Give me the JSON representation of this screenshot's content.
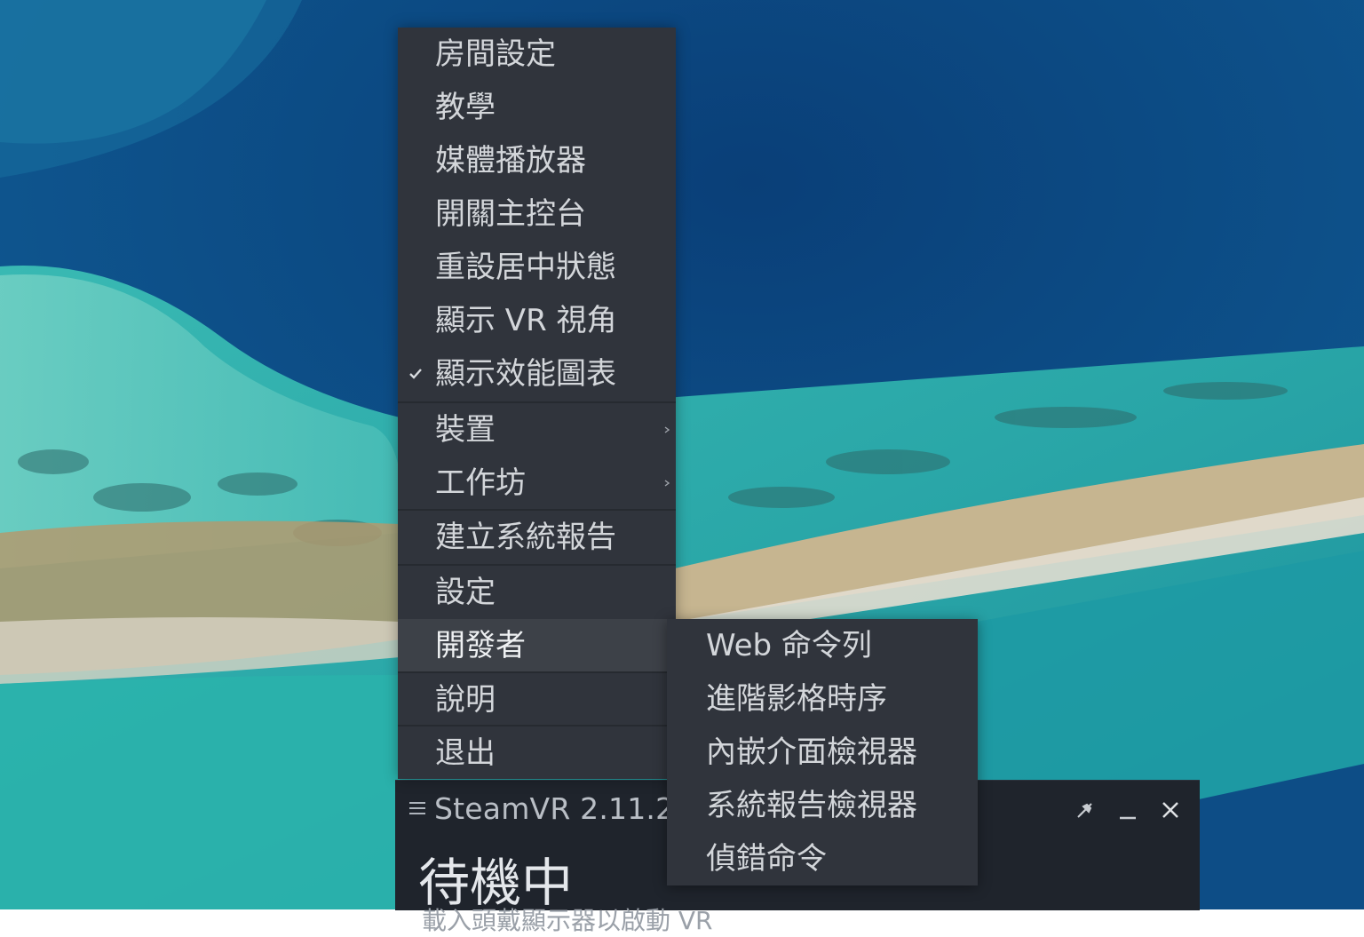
{
  "main_menu": {
    "items": [
      {
        "label": "房間設定"
      },
      {
        "label": "教學"
      },
      {
        "label": "媒體播放器"
      },
      {
        "label": "開關主控台"
      },
      {
        "label": "重設居中狀態"
      },
      {
        "label": "顯示 VR 視角"
      },
      {
        "label": "顯示效能圖表",
        "checked": true
      },
      {
        "label": "裝置",
        "has_submenu": true
      },
      {
        "label": "工作坊",
        "has_submenu": true
      },
      {
        "label": "建立系統報告"
      },
      {
        "label": "設定"
      },
      {
        "label": "開發者",
        "active": true
      },
      {
        "label": "說明"
      },
      {
        "label": "退出"
      }
    ]
  },
  "developer_submenu": {
    "items": [
      {
        "label": "Web 命令列"
      },
      {
        "label": "進階影格時序"
      },
      {
        "label": "內嵌介面檢視器"
      },
      {
        "label": "系統報告檢視器"
      },
      {
        "label": "偵錯命令"
      }
    ]
  },
  "status_window": {
    "title": "SteamVR 2.11.2",
    "status": "待機中",
    "subtext": "載入頭戴顯示器以啟動 VR",
    "buttons": {
      "pin_icon": "unpin-icon",
      "minimize_icon": "minimize-icon",
      "close_icon": "close-icon"
    }
  },
  "colors": {
    "menu_bg": "#30343c",
    "menu_active_bg": "#3d4148",
    "menu_text": "#d3d6da",
    "window_bg": "#1f242c"
  }
}
